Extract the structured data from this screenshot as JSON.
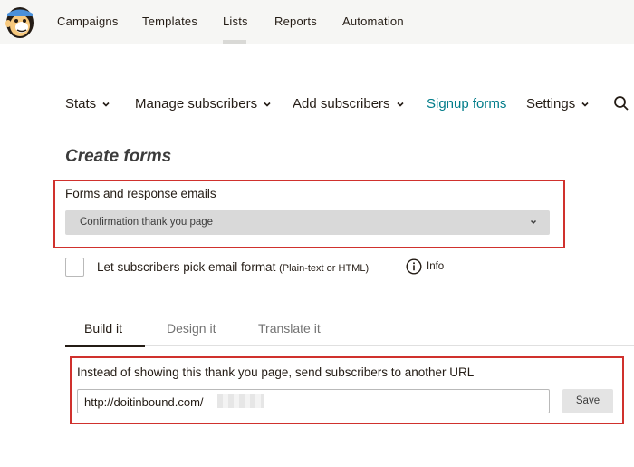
{
  "topnav": {
    "items": [
      {
        "label": "Campaigns"
      },
      {
        "label": "Templates"
      },
      {
        "label": "Lists"
      },
      {
        "label": "Reports"
      },
      {
        "label": "Automation"
      }
    ],
    "active": "Lists"
  },
  "subnav": {
    "items": [
      {
        "label": "Stats"
      },
      {
        "label": "Manage subscribers"
      },
      {
        "label": "Add subscribers"
      },
      {
        "label": "Signup forms"
      },
      {
        "label": "Settings"
      }
    ],
    "active": "Signup forms"
  },
  "page": {
    "title": "Create forms"
  },
  "forms_field": {
    "label": "Forms and response emails",
    "selected": "Confirmation thank you page"
  },
  "email_format": {
    "label": "Let subscribers pick email format",
    "hint": "(Plain-text or HTML)",
    "info": "Info"
  },
  "tabs": [
    {
      "label": "Build it"
    },
    {
      "label": "Design it"
    },
    {
      "label": "Translate it"
    }
  ],
  "active_tab": "Build it",
  "redirect": {
    "label": "Instead of showing this thank you page, send subscribers to another URL",
    "value": "http://doitinbound.com/",
    "save": "Save"
  },
  "colors": {
    "accent": "#007c89",
    "highlight": "#d0312d"
  }
}
